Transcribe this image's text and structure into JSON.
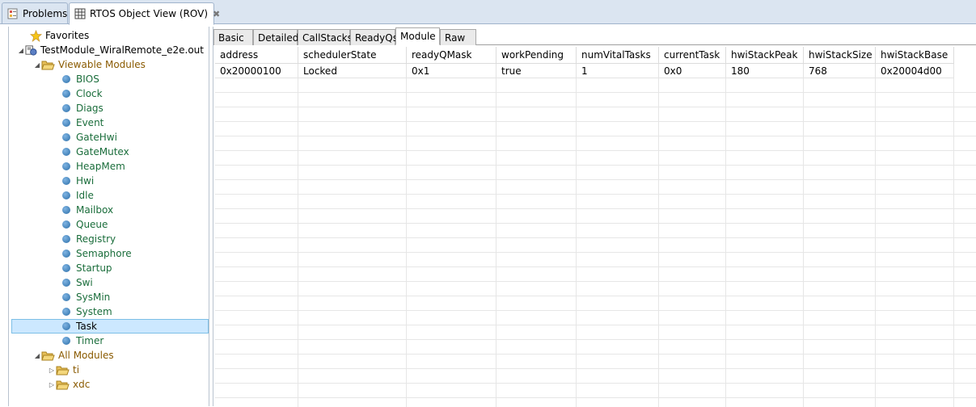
{
  "view_tabs": {
    "problems_label": "Problems",
    "rov_label": "RTOS Object View (ROV)",
    "close_glyph": "✖"
  },
  "tree": {
    "favorites": "Favorites",
    "program": "TestModule_WiralRemote_e2e.out",
    "viewable_modules": "Viewable Modules",
    "modules": [
      "BIOS",
      "Clock",
      "Diags",
      "Event",
      "GateHwi",
      "GateMutex",
      "HeapMem",
      "Hwi",
      "Idle",
      "Mailbox",
      "Queue",
      "Registry",
      "Semaphore",
      "Startup",
      "Swi",
      "SysMin",
      "System",
      "Task",
      "Timer"
    ],
    "selected": "Task",
    "all_modules": "All Modules",
    "packages": [
      "ti",
      "xdc"
    ]
  },
  "inner_tabs": [
    "Basic",
    "Detailed",
    "CallStacks",
    "ReadyQs",
    "Module",
    "Raw"
  ],
  "active_inner_tab": "Module",
  "table": {
    "columns": [
      "address",
      "schedulerState",
      "readyQMask",
      "workPending",
      "numVitalTasks",
      "currentTask",
      "hwiStackPeak",
      "hwiStackSize",
      "hwiStackBase"
    ],
    "rows": [
      [
        "0x20000100",
        "Locked",
        "0x1",
        "true",
        "1",
        "0x0",
        "180",
        "768",
        "0x20004d00"
      ]
    ]
  },
  "colors": {
    "module_text": "#1a6d3b",
    "category_text": "#8a5a00",
    "selection": "#cce8ff"
  }
}
